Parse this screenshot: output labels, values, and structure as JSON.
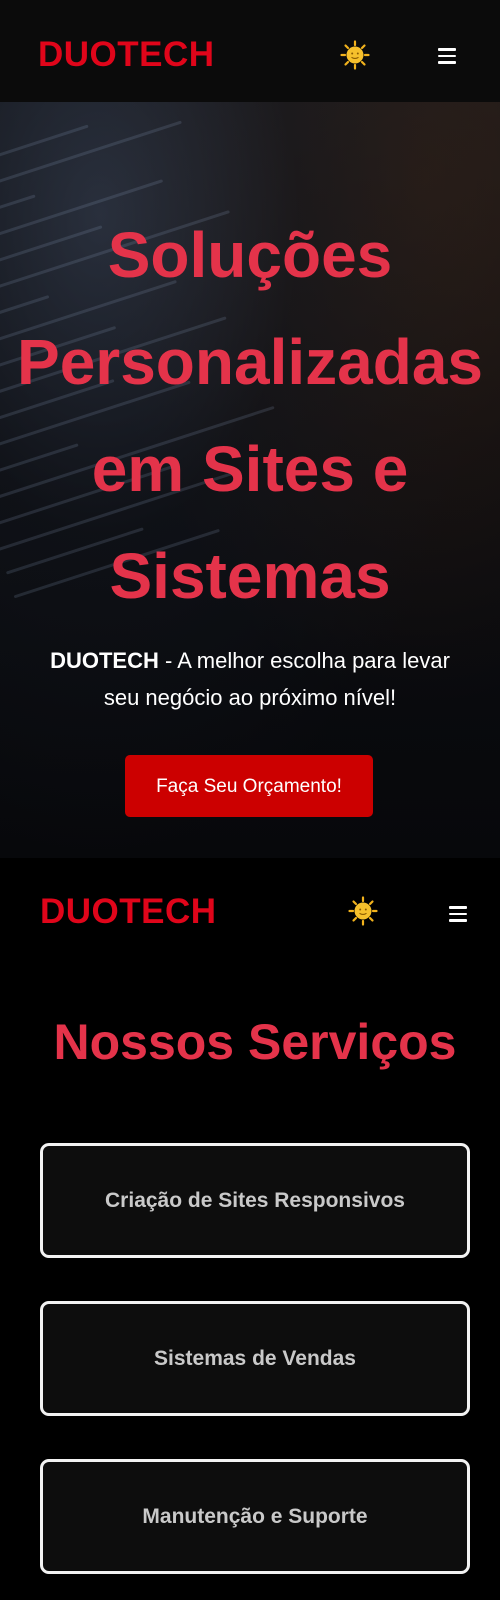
{
  "header": {
    "logo": "DUOTECH",
    "theme_toggle_icon": "sun-icon",
    "menu_icon": "hamburger-menu-icon"
  },
  "hero": {
    "title": "Soluções Personalizadas em Sites e Sistemas",
    "subtitle_brand": "DUOTECH",
    "subtitle_text": " - A melhor escolha para levar seu negócio ao próximo nível!",
    "cta_label": "Faça Seu Orçamento!"
  },
  "header2": {
    "logo": "DUOTECH",
    "theme_toggle_icon": "sun-icon",
    "menu_icon": "hamburger-menu-icon"
  },
  "services": {
    "title": "Nossos Serviços",
    "items": [
      {
        "label": "Criação de Sites Responsivos"
      },
      {
        "label": "Sistemas de Vendas"
      },
      {
        "label": "Manutenção e Suporte"
      }
    ]
  },
  "colors": {
    "brand_red": "#e0051a",
    "heading_red": "#e4334a",
    "cta_red": "#cc0000",
    "background": "#000000"
  }
}
